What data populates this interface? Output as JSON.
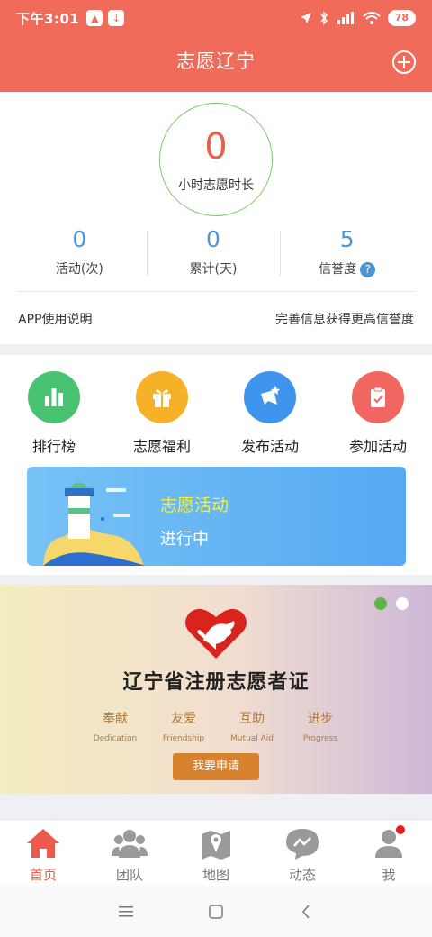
{
  "status": {
    "time": "下午3:01",
    "battery": "78"
  },
  "header": {
    "title": "志愿辽宁"
  },
  "summary": {
    "hours_value": "0",
    "hours_label": "小时志愿时长",
    "stats": [
      {
        "value": "0",
        "label": "活动(次)"
      },
      {
        "value": "0",
        "label": "累计(天)"
      },
      {
        "value": "5",
        "label": "信誉度"
      }
    ],
    "help_icon": "?",
    "link_left": "APP使用说明",
    "link_right": "完善信息获得更高信誉度"
  },
  "grid": [
    {
      "label": "排行榜",
      "icon": "ranking-icon",
      "color": "#49c271"
    },
    {
      "label": "志愿福利",
      "icon": "gift-icon",
      "color": "#f6b128"
    },
    {
      "label": "发布活动",
      "icon": "publish-icon",
      "color": "#3f95ee"
    },
    {
      "label": "参加活动",
      "icon": "clipboard-icon",
      "color": "#f26661"
    }
  ],
  "banner": {
    "title": "志愿活动",
    "subtitle": "进行中"
  },
  "certificate": {
    "title": "辽宁省注册志愿者证",
    "values": [
      {
        "zh": "奉献",
        "en": "Dedication"
      },
      {
        "zh": "友爱",
        "en": "Friendship"
      },
      {
        "zh": "互助",
        "en": "Mutual Aid"
      },
      {
        "zh": "进步",
        "en": "Progress"
      }
    ],
    "button": "我要申请",
    "carousel_active_index": 0
  },
  "tabs": [
    {
      "label": "首页",
      "icon": "home-icon",
      "active": true
    },
    {
      "label": "团队",
      "icon": "team-icon",
      "active": false
    },
    {
      "label": "地图",
      "icon": "map-icon",
      "active": false
    },
    {
      "label": "动态",
      "icon": "chat-icon",
      "active": false
    },
    {
      "label": "我",
      "icon": "profile-icon",
      "active": false
    }
  ],
  "colors": {
    "primary": "#f06b59",
    "accent_blue": "#4b97d6",
    "active_tab": "#ea5b4b"
  }
}
